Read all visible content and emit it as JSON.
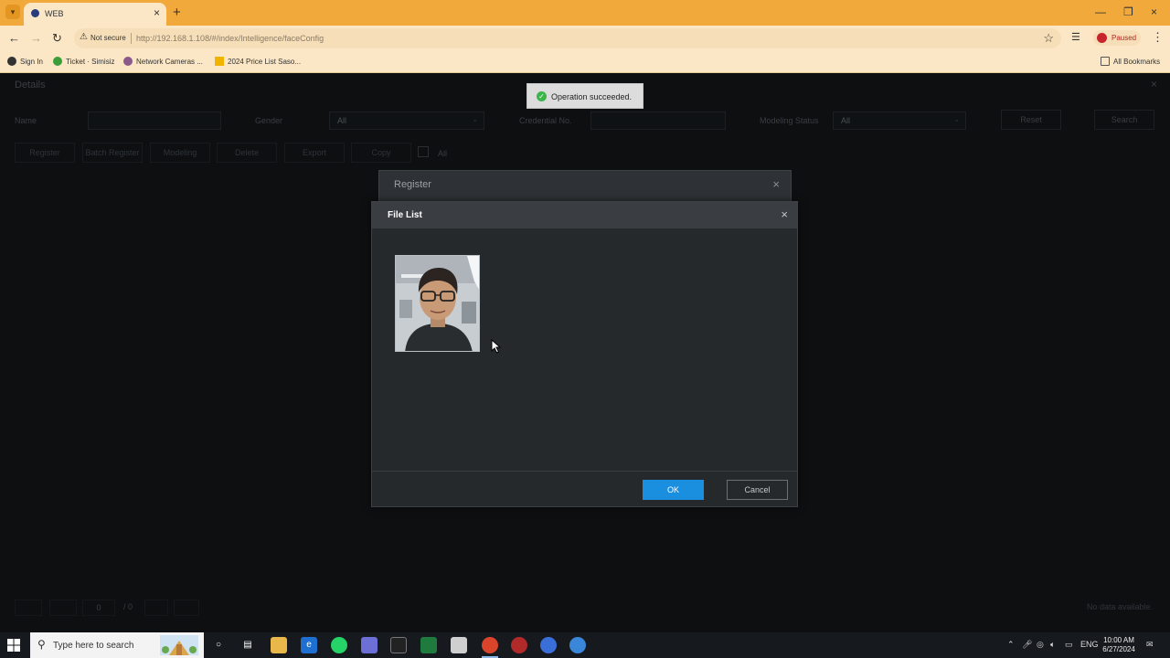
{
  "browser": {
    "tab_title": "WEB",
    "security_label": "Not secure",
    "url": "http://192.168.1.108/#/index/Intelligence/faceConfig",
    "profile_status": "Paused",
    "bookmarks": [
      "Sign In",
      "Ticket · Simisiz",
      "Network Cameras ...",
      "2024 Price List Saso..."
    ],
    "all_bookmarks": "All Bookmarks"
  },
  "page": {
    "title": "Details",
    "filters": {
      "name_label": "Name",
      "gender_label": "Gender",
      "gender_value": "All",
      "credential_label": "Credential No.",
      "modeling_label": "Modeling Status",
      "modeling_value": "All",
      "reset": "Reset",
      "search": "Search"
    },
    "actions": [
      "Register",
      "Batch Register",
      "Modeling",
      "Delete",
      "Export",
      "Copy"
    ],
    "all_label": "All",
    "pagination": {
      "current": "0",
      "total": "/ 0"
    },
    "no_data": "No data available."
  },
  "register_dialog": {
    "title": "Register"
  },
  "file_list_dialog": {
    "title": "File List",
    "ok": "OK",
    "cancel": "Cancel"
  },
  "toast": {
    "message": "Operation succeeded."
  },
  "taskbar": {
    "search_placeholder": "Type here to search",
    "language": "ENG",
    "time": "10:00 AM",
    "date": "6/27/2024"
  },
  "colors": {
    "browser_accent": "#f2a93b",
    "primary_button": "#1a8fe0",
    "success": "#39b54a"
  }
}
